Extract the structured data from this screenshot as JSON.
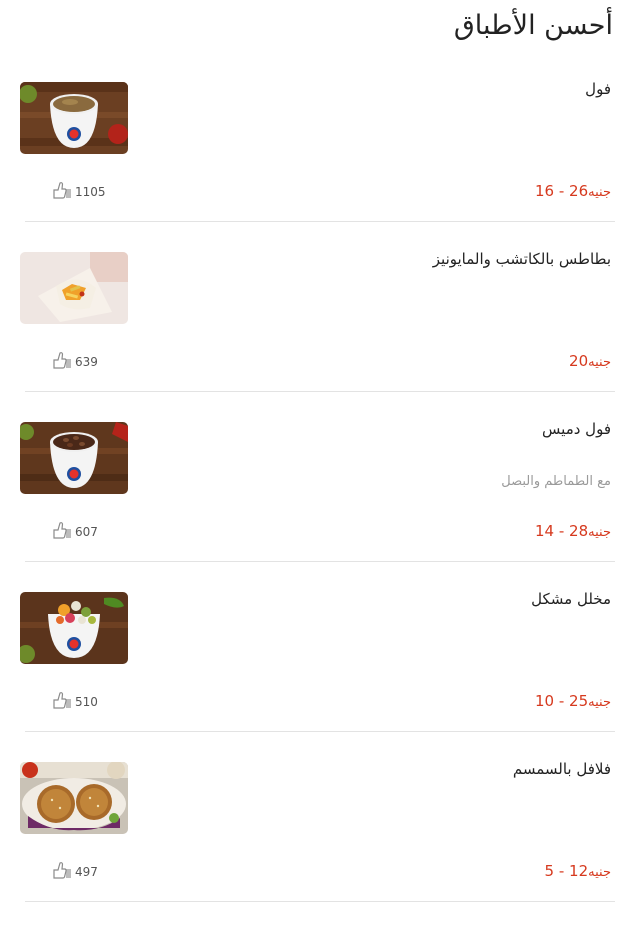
{
  "page_title": "أحسن الأطباق",
  "icons": {
    "like": "thumbs-up-icon"
  },
  "colors": {
    "price": "#d6391e",
    "text": "#222222",
    "muted": "#9a9a9a"
  },
  "items": [
    {
      "name": "فول",
      "description": "",
      "price": "16 - 26",
      "currency": "جنيه",
      "likes": "1105"
    },
    {
      "name": "بطاطس بالكاتشب والمايونيز",
      "description": "",
      "price": "20",
      "currency": "جنيه",
      "likes": "639"
    },
    {
      "name": "فول دميس",
      "description": "مع الطماطم والبصل",
      "price": "14 - 28",
      "currency": "جنيه",
      "likes": "607"
    },
    {
      "name": "مخلل مشكل",
      "description": "",
      "price": "10 - 25",
      "currency": "جنيه",
      "likes": "510"
    },
    {
      "name": "فلافل بالسمسم",
      "description": "",
      "price": "5 - 12",
      "currency": "جنيه",
      "likes": "497"
    }
  ]
}
